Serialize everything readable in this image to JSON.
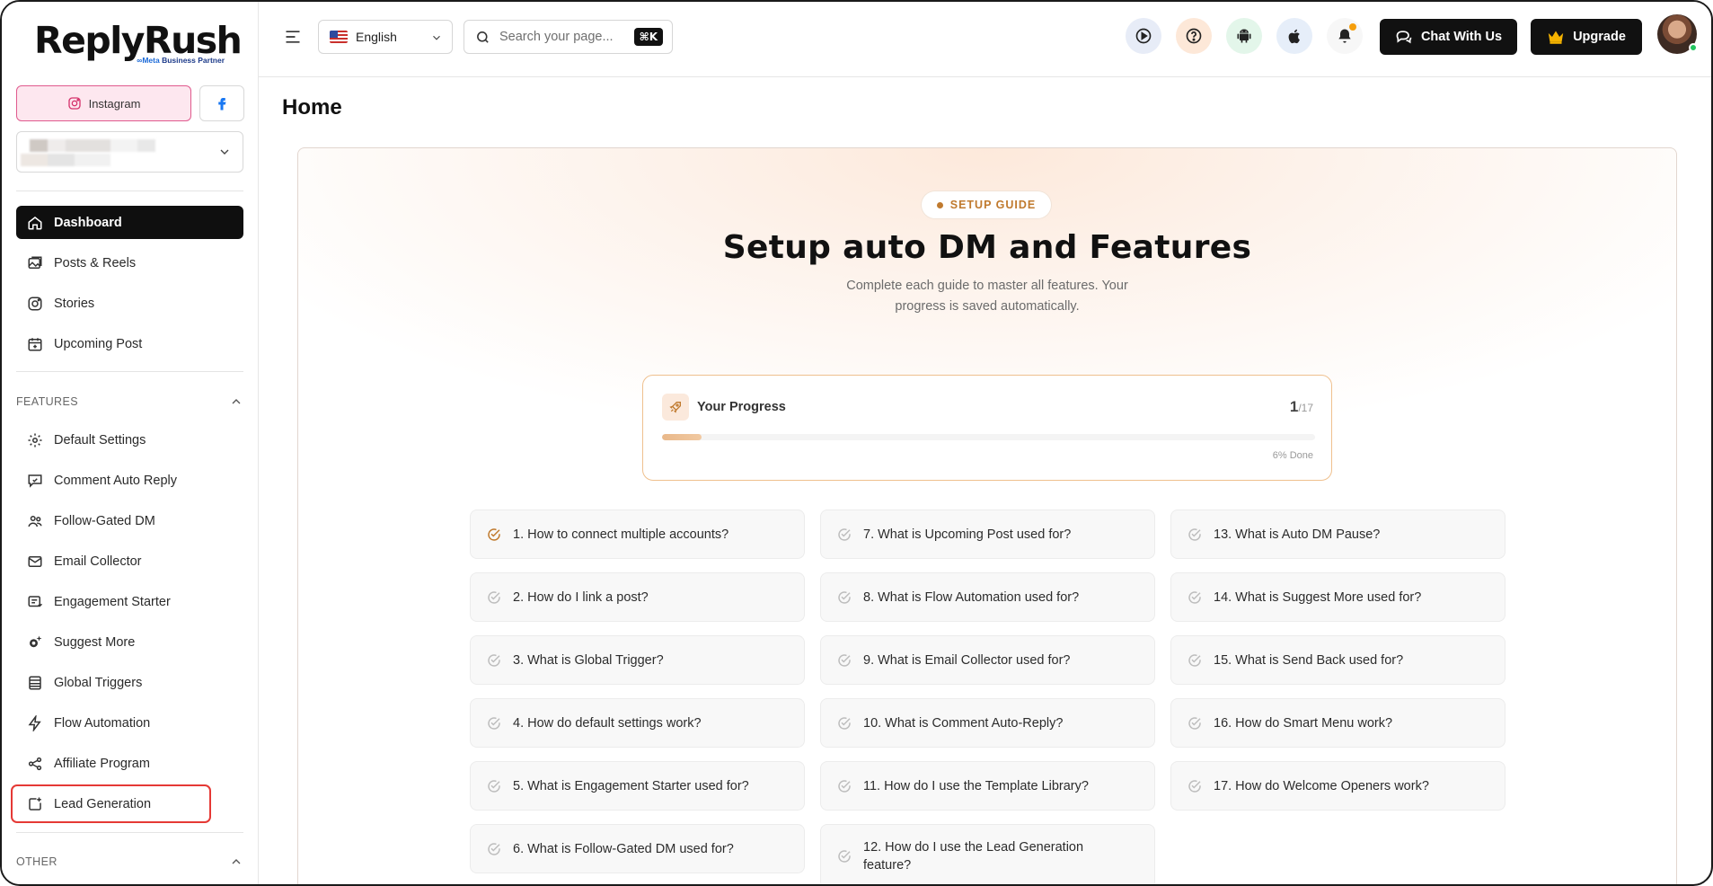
{
  "app": {
    "logo_text": "ReplyRush",
    "logo_sub_meta": "∞Meta",
    "logo_sub": " Business Partner"
  },
  "sidebar": {
    "platforms": {
      "instagram": "Instagram"
    },
    "main_items": [
      {
        "label": "Dashboard",
        "icon": "home-icon"
      },
      {
        "label": "Posts & Reels",
        "icon": "image-icon"
      },
      {
        "label": "Stories",
        "icon": "instagram-icon"
      },
      {
        "label": "Upcoming Post",
        "icon": "calendar-plus-icon"
      }
    ],
    "features_title": "FEATURES",
    "feature_items": [
      {
        "label": "Default Settings",
        "icon": "gear-icon"
      },
      {
        "label": "Comment Auto Reply",
        "icon": "comment-icon"
      },
      {
        "label": "Follow-Gated DM",
        "icon": "users-icon"
      },
      {
        "label": "Email Collector",
        "icon": "mail-icon"
      },
      {
        "label": "Engagement Starter",
        "icon": "message-list-icon"
      },
      {
        "label": "Suggest More",
        "icon": "sparkle-gear-icon"
      },
      {
        "label": "Global Triggers",
        "icon": "list-icon"
      },
      {
        "label": "Flow Automation",
        "icon": "bolt-icon"
      },
      {
        "label": "Affiliate Program",
        "icon": "share-icon"
      },
      {
        "label": "Lead Generation",
        "icon": "lead-icon"
      }
    ],
    "other_title": "OTHER"
  },
  "topbar": {
    "language": "English",
    "search_placeholder": "Search your page...",
    "search_shortcut": "⌘K",
    "chat_label": "Chat With Us",
    "upgrade_label": "Upgrade"
  },
  "main": {
    "page_title": "Home",
    "badge": "SETUP GUIDE",
    "hero_title": "Setup auto DM and Features",
    "hero_subtitle": "Complete each guide to master all features. Your progress is saved automatically.",
    "progress": {
      "label": "Your Progress",
      "completed": "1",
      "total": "/17",
      "fraction": 0.06,
      "done_text": "6% Done"
    },
    "guides": [
      {
        "label": "1. How to connect multiple accounts?",
        "done": true
      },
      {
        "label": "2. How do I link a post?",
        "done": false
      },
      {
        "label": "3. What is Global Trigger?",
        "done": false
      },
      {
        "label": "4. How do default settings work?",
        "done": false
      },
      {
        "label": "5. What is Engagement Starter used for?",
        "done": false
      },
      {
        "label": "6. What is Follow-Gated DM used for?",
        "done": false
      },
      {
        "label": "7. What is Upcoming Post used for?",
        "done": false
      },
      {
        "label": "8. What is Flow Automation used for?",
        "done": false
      },
      {
        "label": "9. What is Email Collector used for?",
        "done": false
      },
      {
        "label": "10. What is Comment Auto-Reply?",
        "done": false
      },
      {
        "label": "11. How do I use the Template Library?",
        "done": false
      },
      {
        "label": "12. How do I use the Lead Generation feature?",
        "done": false
      },
      {
        "label": "13. What is Auto DM Pause?",
        "done": false
      },
      {
        "label": "14. What is Suggest More used for?",
        "done": false
      },
      {
        "label": "15. What is Send Back used for?",
        "done": false
      },
      {
        "label": "16. How do Smart Menu work?",
        "done": false
      },
      {
        "label": "17. How do Welcome Openers work?",
        "done": false
      }
    ]
  },
  "colors": {
    "accent": "#c07a2e",
    "highlight": "#e53935",
    "dark": "#111111"
  }
}
